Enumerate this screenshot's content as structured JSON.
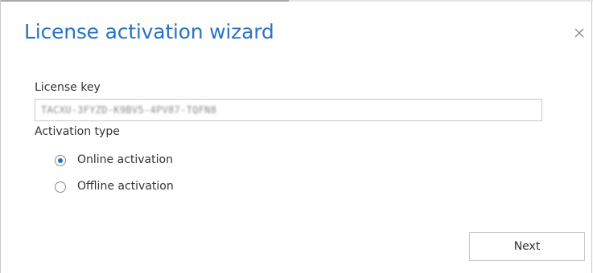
{
  "dialog": {
    "title": "License activation wizard",
    "close_icon": "close-icon",
    "accent_color": "#2b73c4"
  },
  "license": {
    "label": "License key",
    "value": "TACXU-3FYZD-K9BV5-4PV87-TQFN8"
  },
  "activation": {
    "label": "Activation type",
    "options": [
      {
        "label": "Online activation",
        "selected": true
      },
      {
        "label": "Offline activation",
        "selected": false
      }
    ]
  },
  "footer": {
    "next_label": "Next"
  }
}
